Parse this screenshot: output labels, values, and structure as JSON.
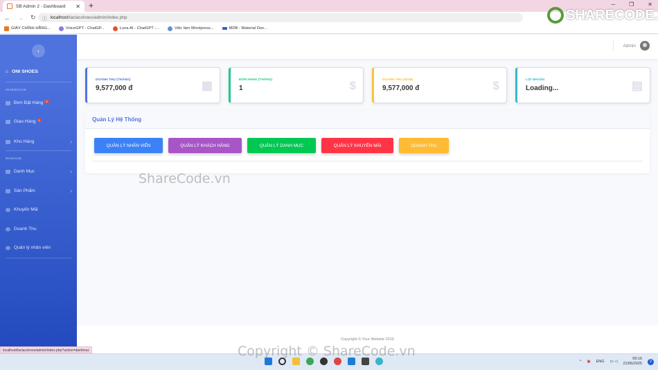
{
  "browser": {
    "tab_title": "SB Admin 2 - Dashboard",
    "url_host": "localhost",
    "url_path": "/laclacshoes/admin/index.php",
    "bookmarks": [
      "GIÀY CHÍNH HÃNG...",
      "VoiceGPT - ChatGP...",
      "Luna AI - ChatGPT -...",
      "Việc làm Wordpress...",
      "MDB - Material Des..."
    ],
    "status_url": "localhost/laclacshoes/admin/index.php?action=danhmuc"
  },
  "sidebar": {
    "brand": "ONI SHOES",
    "section_interface": "INTERFACE",
    "section_manage": "MANAGE",
    "items": [
      {
        "label": "Đơn Đặt Hàng",
        "badge": "2"
      },
      {
        "label": "Giao Hàng",
        "badge": "1"
      },
      {
        "label": "Kho Hàng"
      },
      {
        "label": "Danh Mục"
      },
      {
        "label": "Sản Phẩm"
      },
      {
        "label": "Khuyến Mãi"
      },
      {
        "label": "Doanh Thu"
      },
      {
        "label": "Quản lý nhân viên"
      }
    ]
  },
  "topbar": {
    "user": "Admin"
  },
  "cards": [
    {
      "label": "Doanh thu (tháng)",
      "value": "9,577,000 đ",
      "color": "#4e73df",
      "icon": "calendar-icon"
    },
    {
      "label": "Đơn hàng (tháng)",
      "value": "1",
      "color": "#1cc88a",
      "icon": "dollar-icon"
    },
    {
      "label": "Doanh thu (năm)",
      "value": "9,577,000 đ",
      "color": "#f6c23e",
      "icon": "dollar-icon"
    },
    {
      "label": "Lợi nhuận",
      "value": "Loading...",
      "color": "#36b9cc",
      "icon": "clipboard-icon"
    }
  ],
  "panel": {
    "title": "Quản Lý Hệ Thống",
    "buttons": [
      {
        "label": "QUẢN LÝ NHÂN VIÊN",
        "color": "#3b82f6"
      },
      {
        "label": "QUẢN LÝ KHÁCH HÀNG",
        "color": "#a855c7"
      },
      {
        "label": "QUẢN LÝ DANH MỤC",
        "color": "#00c853"
      },
      {
        "label": "QUẢN LÝ KHUYẾN MÃI",
        "color": "#ff3547"
      },
      {
        "label": "DOANH THU",
        "color": "#ffbb33"
      }
    ]
  },
  "footer": "Copyright © Your Website 2019",
  "taskbar": {
    "lang": "ENG",
    "time": "09:16",
    "date": "21/06/2025",
    "notif": "2"
  },
  "watermark": {
    "logo": "SHARECODE.vn",
    "center": "ShareCode.vn",
    "bottom": "Copyright © ShareCode.vn"
  }
}
